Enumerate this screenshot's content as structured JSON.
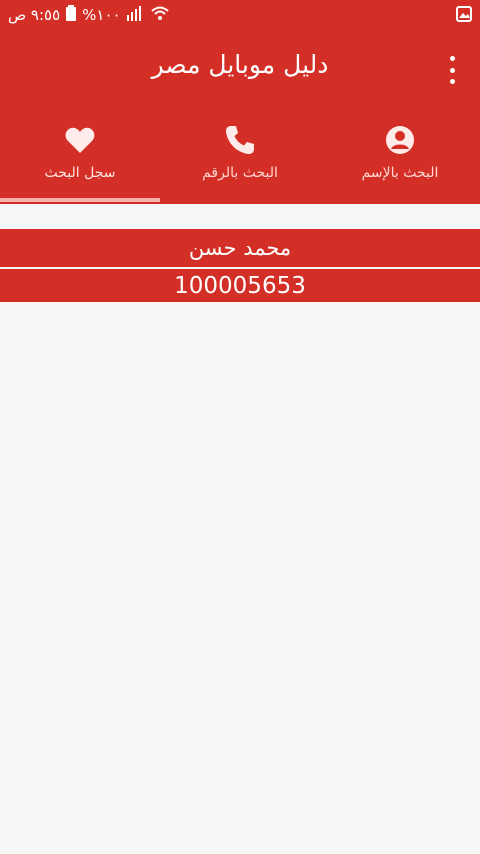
{
  "status_bar": {
    "time": "٩:٥٥ ص",
    "battery": "%١٠٠",
    "icons": [
      "wifi-icon",
      "signal-icon",
      "battery-icon",
      "gallery-icon"
    ]
  },
  "app": {
    "title": "دليل موبايل مصر",
    "menu_icon": "overflow-menu-icon"
  },
  "tabs": [
    {
      "label": "سجل البحث",
      "icon": "heart-icon",
      "active": true
    },
    {
      "label": "البحث بالرقم",
      "icon": "phone-icon",
      "active": false
    },
    {
      "label": "البحث بالإسم",
      "icon": "person-icon",
      "active": false
    }
  ],
  "result": {
    "name": "محمد حسن",
    "number": "100005653"
  },
  "colors": {
    "primary": "#d32f26",
    "background": "#f7f7f7",
    "tab_indicator": "#f6b2ab"
  }
}
